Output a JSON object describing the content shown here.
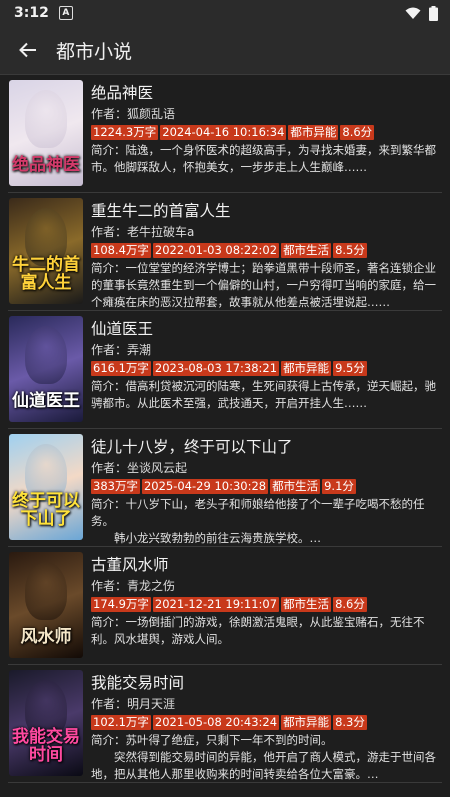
{
  "status": {
    "time": "3:12",
    "notif": "A"
  },
  "appbar": {
    "title": "都市小说"
  },
  "books": [
    {
      "title": "绝品神医",
      "author": "作者：狐颜乱语",
      "words": "1224.3万字",
      "updated": "2024-04-16 10:16:34",
      "category": "都市异能",
      "score": "8.6分",
      "intro": "简介：陆逸，一个身怀医术的超级高手，为寻找未婚妻，来到繁华都市。他脚踩敌人，怀抱美女，一步步走上人生巅峰……",
      "cover_text": "绝品神医",
      "cover_colors": [
        "#d9d4e6",
        "#f0e8ef",
        "#c6bcd0"
      ],
      "cover_text_color": "#d23a6a"
    },
    {
      "title": "重生牛二的首富人生",
      "author": "作者：老牛拉破车a",
      "words": "108.4万字",
      "updated": "2022-01-03 08:22:02",
      "category": "都市生活",
      "score": "8.5分",
      "intro": "简介：一位堂堂的经济学博士；跆拳道黑带十段师圣，著名连锁企业的董事长竟然重生到一个偏僻的山村，一户穷得叮当响的家庭，给一个瘫痪在床的恶汉拉帮套，故事就从他差点被活埋说起……",
      "cover_text": "牛二的首富人生",
      "cover_colors": [
        "#3a2a1a",
        "#8a6a2a",
        "#1a1a1a"
      ],
      "cover_text_color": "#ffd23a"
    },
    {
      "title": "仙道医王",
      "author": "作者：弄潮",
      "words": "616.1万字",
      "updated": "2023-08-03 17:38:21",
      "category": "都市异能",
      "score": "9.5分",
      "intro": "简介：借高利贷被沉河的陆寒，生死间获得上古传承，逆天崛起，驰骋都市。从此医术至强，武技通天，开启开挂人生……",
      "cover_text": "仙道医王",
      "cover_colors": [
        "#2a2a5a",
        "#6a5aa8",
        "#1a1a3a"
      ],
      "cover_text_color": "#ffffff"
    },
    {
      "title": "徒儿十八岁，终于可以下山了",
      "author": "作者：坐谈风云起",
      "words": "383万字",
      "updated": "2025-04-29 10:30:28",
      "category": "都市生活",
      "score": "9.1分",
      "intro": "简介：十八岁下山，老头子和师娘给他接了个一辈子吃喝不愁的任务。\n　　韩小龙兴致勃勃的前往云海贵族学校。…",
      "cover_text": "终于可以下山了",
      "cover_colors": [
        "#9fd0f0",
        "#f3d9c6",
        "#6aa6d6"
      ],
      "cover_text_color": "#ffe23a"
    },
    {
      "title": "古董风水师",
      "author": "作者：青龙之伤",
      "words": "174.9万字",
      "updated": "2021-12-21 19:11:07",
      "category": "都市生活",
      "score": "8.6分",
      "intro": "简介：一场倒插门的游戏，徐朗激活鬼眼，从此鉴宝赌石，无往不利。风水堪舆，游戏人间。",
      "cover_text": "风水师",
      "cover_colors": [
        "#2a1a10",
        "#6a4a2a",
        "#120a06"
      ],
      "cover_text_color": "#f4e6c8"
    },
    {
      "title": "我能交易时间",
      "author": "作者：明月天涯",
      "words": "102.1万字",
      "updated": "2021-05-08 20:43:24",
      "category": "都市异能",
      "score": "8.3分",
      "intro": "简介：苏叶得了绝症，只剩下一年不到的时间。\n　　突然得到能交易时间的异能，他开启了商人模式，游走于世间各地，把从其他人那里收购来的时间转卖给各位大富豪。…",
      "cover_text": "我能交易时间",
      "cover_colors": [
        "#1a1a2a",
        "#4a3a6a",
        "#0a0a14"
      ],
      "cover_text_color": "#ff4aa0"
    }
  ]
}
